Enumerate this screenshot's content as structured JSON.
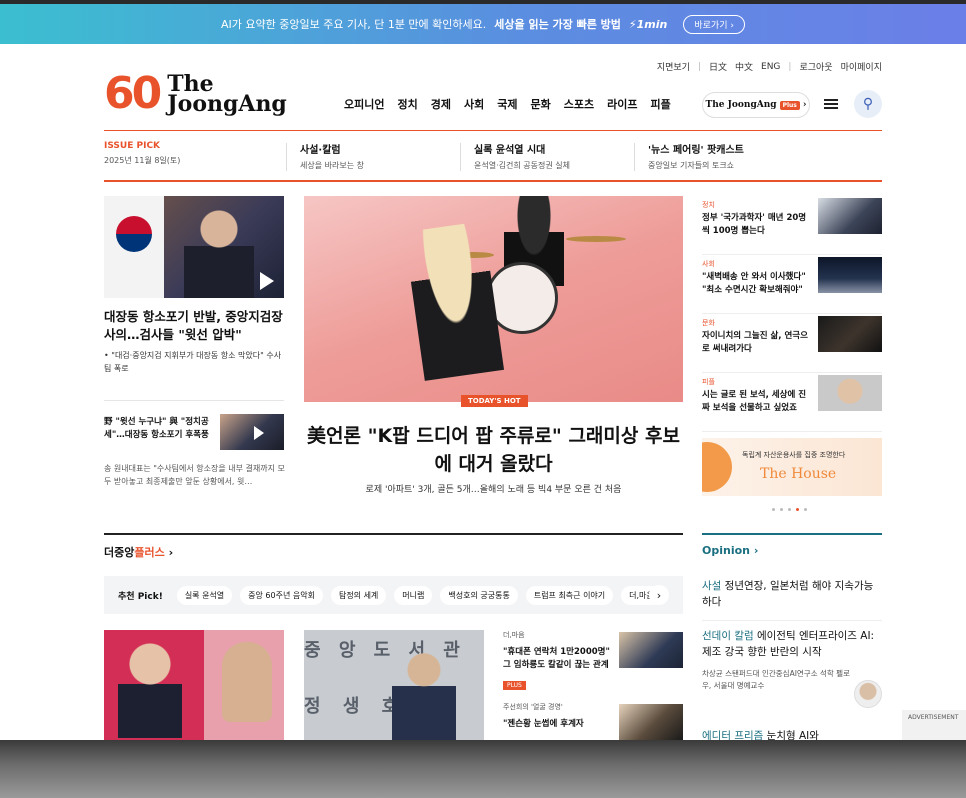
{
  "promo": {
    "text": "AI가 요약한 중앙일보 주요 기사, 단 1분 만에 확인하세요.",
    "highlight": "세상을 읽는 가장 빠른 방법",
    "brand": "⚡1min",
    "button": "바로가기 ›"
  },
  "util": {
    "paper": "지면보기",
    "lang_ja": "日文",
    "lang_zh": "中文",
    "lang_en": "ENG",
    "logout": "로그아웃",
    "mypage": "마이페이지"
  },
  "logo": {
    "sixty": "60",
    "line1": "The",
    "line2": "JoongAng"
  },
  "nav": [
    "오피니언",
    "정치",
    "경제",
    "사회",
    "국제",
    "문화",
    "스포츠",
    "라이프",
    "피플"
  ],
  "plus_button": {
    "label": "The JoongAng",
    "tag": "Plus",
    "arrow": "›"
  },
  "issue": {
    "label": "ISSUE PICK",
    "date": "2025년 11월 8일(토)",
    "items": [
      {
        "title": "사설·칼럼",
        "sub": "세상을 바라보는 창"
      },
      {
        "title": "실록 윤석열 시대",
        "sub": "윤석열·김건희 공동정권 실체"
      },
      {
        "title": "'뉴스 페어링' 팟캐스트",
        "sub": "중앙일보 기자들의 토크쇼"
      }
    ]
  },
  "left": {
    "title": "대장동 항소포기 반발, 중앙지검장 사의…검사들 \"윗선 압박\"",
    "sub": "• \"대검·중앙지검 지휘부가 대장동 항소 막았다\" 수사팀 폭로",
    "second_title": "野 \"윗선 누구냐\" 與 \"정치공세\"…대장동 항소포기 후폭풍",
    "second_sub": "송 원내대표는 \"수사팀에서 항소장을 내부 결재까지 모두 받아놓고 최종제출만 앞둔 상황에서, 윗…"
  },
  "center": {
    "badge": "TODAY'S HOT",
    "title": "美언론 \"K팝 드디어 팝 주류로\" 그래미상 후보에 대거 올랐다",
    "sub": "로제 '아파트' 3개, 골든 5개…올해의 노래 등 빅4 부문 오른 건 처음"
  },
  "right": [
    {
      "cat": "정치",
      "title": "정부 '국가과학자' 매년 20명씩 100명 뽑는다"
    },
    {
      "cat": "사회",
      "title": "\"새벽배송 안 와서 이사했다\" \"최소 수면시간 확보해줘야\""
    },
    {
      "cat": "문화",
      "title": "자이니치의 그늘진 삶, 연극으로 써내려가다"
    },
    {
      "cat": "피플",
      "title": "시는 글로 된 보석, 세상에 진짜 보석을 선물하고 싶었죠"
    }
  ],
  "ad": {
    "sub": "독립계 자산운용사를 집중 조명한다",
    "brand": "The House"
  },
  "plus_section": {
    "title_a": "더중앙",
    "title_b": "플러스",
    "arrow": "›"
  },
  "chips": {
    "label": "추천 Pick!",
    "items": [
      "실록 윤석열",
      "중앙 60주년 음악회",
      "탐정의 세계",
      "머니랩",
      "백성호의 궁궁통통",
      "트럼프 최측근 이야기",
      "더,마음"
    ],
    "next": "›"
  },
  "bottom_list": [
    {
      "cat": "더,마음",
      "title": "\"휴대폰 연락처 1만2000명\" 그 임하룡도 칼같이 끊는 관계",
      "plus": "PLUS"
    },
    {
      "cat": "주선희의 '얼굴 경영'",
      "title": "\"젠슨황 눈썹에 후계자"
    }
  ],
  "opinion": {
    "title": "Opinion ›",
    "items": [
      {
        "cat": "사설",
        "title": "정년연장, 일본처럼 해야 지속가능하다"
      },
      {
        "cat": "선데이 칼럼",
        "title": "에이전틱 엔터프라이즈 AI: 제조 강국 향한 반란의 시작",
        "sub": "차상균 스탠퍼드대 인간중심AI연구소 석학 펠로우, 서울대 명예교수"
      },
      {
        "cat": "에디터 프리즘",
        "title": "눈치형 AI와"
      }
    ]
  },
  "advert": "ADVERTISEMENT"
}
